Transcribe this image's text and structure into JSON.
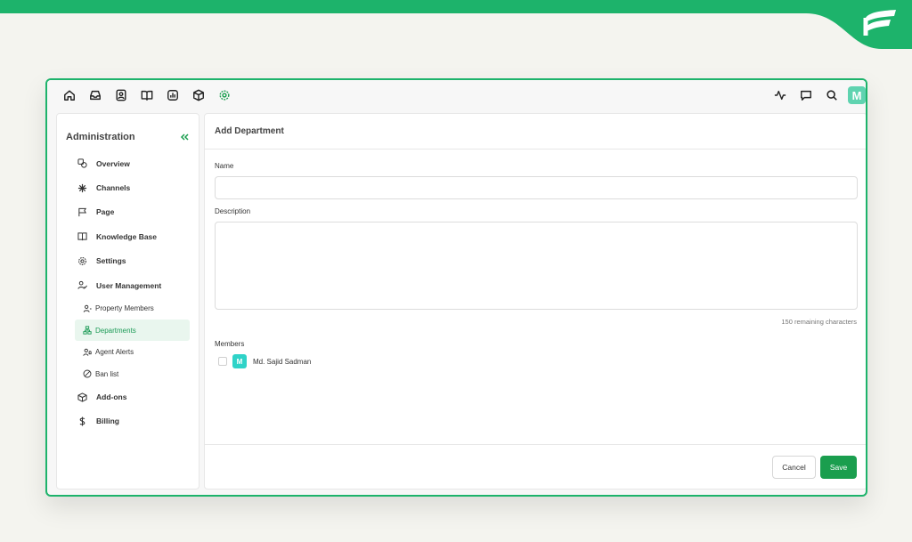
{
  "colors": {
    "accent": "#1a9e4e",
    "banner": "#1db36b",
    "active_bg": "#e9f6ee",
    "avatar": "#5fd3b0",
    "member_avatar": "#2fd3c8"
  },
  "topbar": {
    "left_icons": [
      "home-icon",
      "inbox-icon",
      "contacts-icon",
      "book-icon",
      "reports-icon",
      "box-icon",
      "settings-icon"
    ],
    "right_icons": [
      "activity-icon",
      "chat-icon",
      "search-icon"
    ],
    "avatar_initial": "M"
  },
  "sidebar": {
    "title": "Administration",
    "collapse_icon": "double-chevron-left-icon",
    "items": [
      {
        "label": "Overview",
        "icon": "overview-icon"
      },
      {
        "label": "Channels",
        "icon": "channels-icon"
      },
      {
        "label": "Page",
        "icon": "flag-icon"
      },
      {
        "label": "Knowledge Base",
        "icon": "book-icon"
      },
      {
        "label": "Settings",
        "icon": "settings-icon"
      },
      {
        "label": "User Management",
        "icon": "user-management-icon"
      }
    ],
    "subitems": [
      {
        "label": "Property Members",
        "icon": "user-icon"
      },
      {
        "label": "Departments",
        "icon": "departments-icon",
        "active": true
      },
      {
        "label": "Agent Alerts",
        "icon": "agent-alerts-icon"
      },
      {
        "label": "Ban list",
        "icon": "ban-icon"
      }
    ],
    "bottom_items": [
      {
        "label": "Add-ons",
        "icon": "box-icon"
      },
      {
        "label": "Billing",
        "icon": "dollar-icon"
      }
    ]
  },
  "main": {
    "title": "Add Department",
    "name_label": "Name",
    "name_value": "",
    "description_label": "Description",
    "description_value": "",
    "remaining": "150 remaining characters",
    "members_label": "Members",
    "members": [
      {
        "initial": "M",
        "name": "Md. Sajid Sadman",
        "checked": false
      }
    ],
    "cancel_label": "Cancel",
    "save_label": "Save"
  }
}
